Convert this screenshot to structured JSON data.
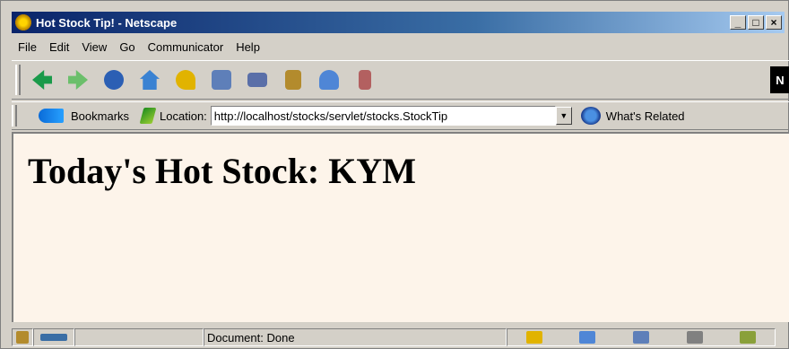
{
  "window": {
    "title": "Hot Stock Tip! - Netscape",
    "controls": [
      "_",
      "□",
      "×"
    ]
  },
  "menu": [
    "File",
    "Edit",
    "View",
    "Go",
    "Communicator",
    "Help"
  ],
  "toolbar": {
    "buttons": [
      {
        "name": "back",
        "icon": "back-arrow-icon",
        "color": "#1a9a4a"
      },
      {
        "name": "forward",
        "icon": "forward-arrow-icon",
        "color": "#6bbf6b"
      },
      {
        "name": "reload",
        "icon": "reload-icon",
        "color": "#2b5fb4"
      },
      {
        "name": "home",
        "icon": "home-icon",
        "color": "#3a82d2"
      },
      {
        "name": "search",
        "icon": "search-icon",
        "color": "#e1b300"
      },
      {
        "name": "my-netscape",
        "icon": "my-netscape-icon",
        "color": "#5e7fb9"
      },
      {
        "name": "print",
        "icon": "print-icon",
        "color": "#5a6fa8"
      },
      {
        "name": "security",
        "icon": "lock-icon",
        "color": "#b38b2d"
      },
      {
        "name": "shop",
        "icon": "shop-icon",
        "color": "#4f86d6"
      },
      {
        "name": "stop",
        "icon": "stop-icon",
        "color": "#b36060"
      }
    ],
    "logo": "N"
  },
  "location_bar": {
    "bookmarks_label": "Bookmarks",
    "location_label": "Location:",
    "url": "http://localhost/stocks/servlet/stocks.StockTip",
    "whats_related_label": "What's Related"
  },
  "content": {
    "headline": "Today's Hot Stock: KYM",
    "background": "#fdf4ea"
  },
  "status_bar": {
    "text": "Document: Done"
  }
}
